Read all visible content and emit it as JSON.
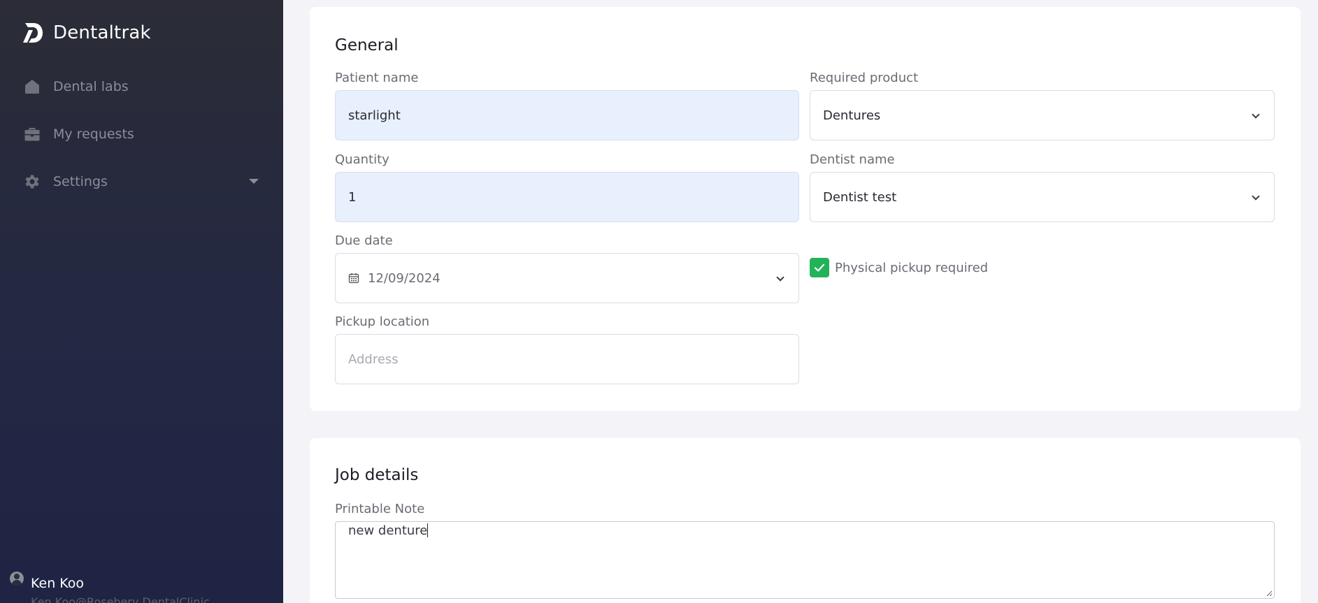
{
  "app": {
    "brand": "Dentaltrak"
  },
  "sidebar": {
    "items": [
      {
        "label": "Dental labs",
        "icon": "home-icon"
      },
      {
        "label": "My requests",
        "icon": "briefcase-icon"
      },
      {
        "label": "Settings",
        "icon": "gear-icon"
      }
    ],
    "user": {
      "name": "Ken Koo",
      "email": "Ken.Koo@Rosebery DentalClinic"
    }
  },
  "general": {
    "title": "General",
    "patient_name": {
      "label": "Patient name",
      "value": "starlight"
    },
    "required_product": {
      "label": "Required product",
      "value": "Dentures"
    },
    "quantity": {
      "label": "Quantity",
      "value": "1"
    },
    "dentist_name": {
      "label": "Dentist name",
      "value": "Dentist test"
    },
    "due_date": {
      "label": "Due date",
      "value": "12/09/2024"
    },
    "physical_pickup": {
      "label": "Physical pickup required",
      "checked": true
    },
    "pickup_location": {
      "label": "Pickup location",
      "placeholder": "Address",
      "value": ""
    }
  },
  "job_details": {
    "title": "Job details",
    "printable_note": {
      "label": "Printable Note",
      "value": "new denture"
    }
  },
  "colors": {
    "accent_green": "#22b358",
    "sidebar_bg": "#232843",
    "filled_input": "#e8f0fe"
  }
}
